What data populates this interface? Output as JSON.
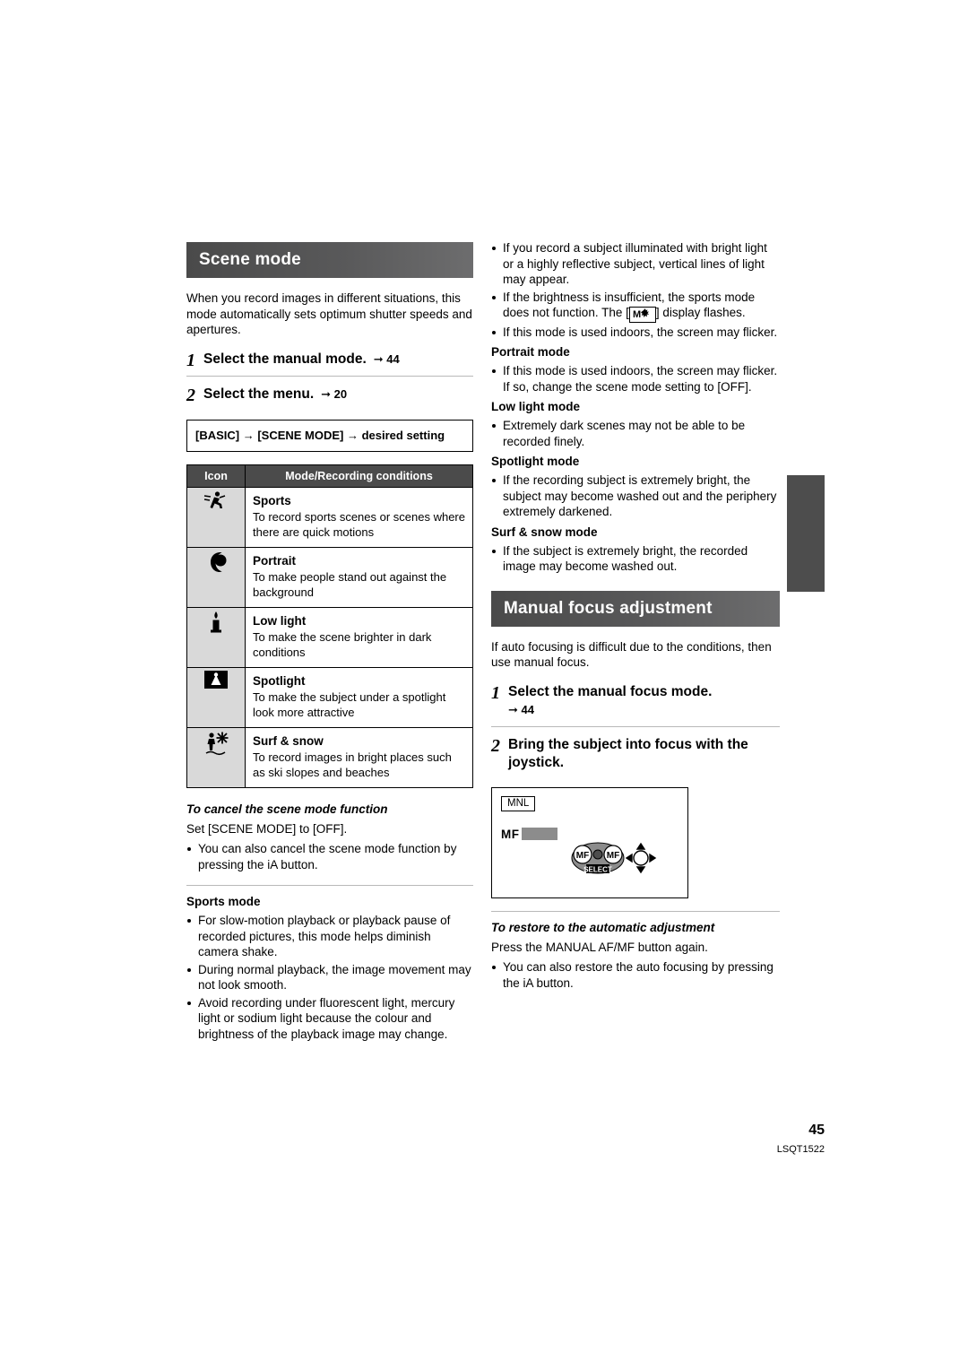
{
  "page": {
    "number": "45",
    "doc_code": "LSQT1522"
  },
  "left_column": {
    "banner_title": "Scene mode",
    "intro": "When you record images in different situations, this mode automatically sets optimum shutter speeds and apertures.",
    "steps": [
      {
        "num": "1",
        "text": "Select the manual mode.",
        "ref": "44"
      },
      {
        "num": "2",
        "text": "Select the menu.",
        "ref": "20"
      }
    ],
    "menu_path": "[BASIC] → [SCENE MODE] → desired setting",
    "table": {
      "headers": [
        "Icon",
        "Mode/Recording conditions"
      ],
      "rows": [
        {
          "icon": "sports-runner-icon",
          "name": "Sports",
          "desc": "To record sports scenes or scenes where there are quick motions"
        },
        {
          "icon": "portrait-person-icon",
          "name": "Portrait",
          "desc": "To make people stand out against the background"
        },
        {
          "icon": "low-light-candle-icon",
          "name": "Low light",
          "desc": "To make the scene brighter in dark conditions"
        },
        {
          "icon": "spotlight-icon",
          "name": "Spotlight",
          "desc": "To make the subject under a spotlight look more attractive"
        },
        {
          "icon": "surf-snow-icon",
          "name": "Surf & snow",
          "desc": "To record images in bright places such as ski slopes and beaches"
        }
      ]
    },
    "cancel_heading": "To cancel the scene mode function",
    "cancel_text": "Set [SCENE MODE] to [OFF].",
    "cancel_bullets": [
      "You can also cancel the scene mode function by pressing the iA button."
    ],
    "sports_heading": "Sports mode",
    "sports_bullets": [
      "For slow-motion playback or playback pause of recorded pictures, this mode helps diminish camera shake.",
      "During normal playback, the image movement may not look smooth.",
      "Avoid recording under fluorescent light, mercury light or sodium light because the colour and brightness of the playback image may change."
    ]
  },
  "right_column": {
    "top_bullets": [
      "If you record a subject illuminated with bright light or a highly reflective subject, vertical lines of light may appear.",
      "If the brightness is insufficient, the sports mode does not function. The [ ] display flashes.",
      "If this mode is used indoors, the screen may flicker."
    ],
    "portrait_heading": "Portrait mode",
    "portrait_bullets": [
      "If this mode is used indoors, the screen may flicker. If so, change the scene mode setting to [OFF]."
    ],
    "lowlight_heading": "Low light mode",
    "lowlight_bullets": [
      "Extremely dark scenes may not be able to be recorded finely."
    ],
    "spotlight_heading": "Spotlight mode",
    "spotlight_bullets": [
      "If the recording subject is extremely bright, the subject may become washed out and the periphery extremely darkened."
    ],
    "surfsnow_heading": "Surf & snow mode",
    "surfsnow_bullets": [
      "If the subject is extremely bright, the recorded image may become washed out."
    ],
    "banner_title": "Manual focus adjustment",
    "mf_intro": "If auto focusing is difficult due to the conditions, then use manual focus.",
    "steps": [
      {
        "num": "1",
        "text": "Select the manual focus mode.",
        "ref": "44"
      },
      {
        "num": "2",
        "text": "Bring the subject into focus with the joystick."
      }
    ],
    "screen": {
      "mnl_label": "MNL",
      "mf_label": "MF",
      "joystick_left_label": "MF",
      "joystick_right_label": "MF",
      "joystick_center_label": "SELECT"
    },
    "restore_heading": "To restore to the automatic adjustment",
    "restore_text": "Press the MANUAL AF/MF button again.",
    "restore_bullets": [
      "You can also restore the auto focusing by pressing the iA button."
    ]
  }
}
